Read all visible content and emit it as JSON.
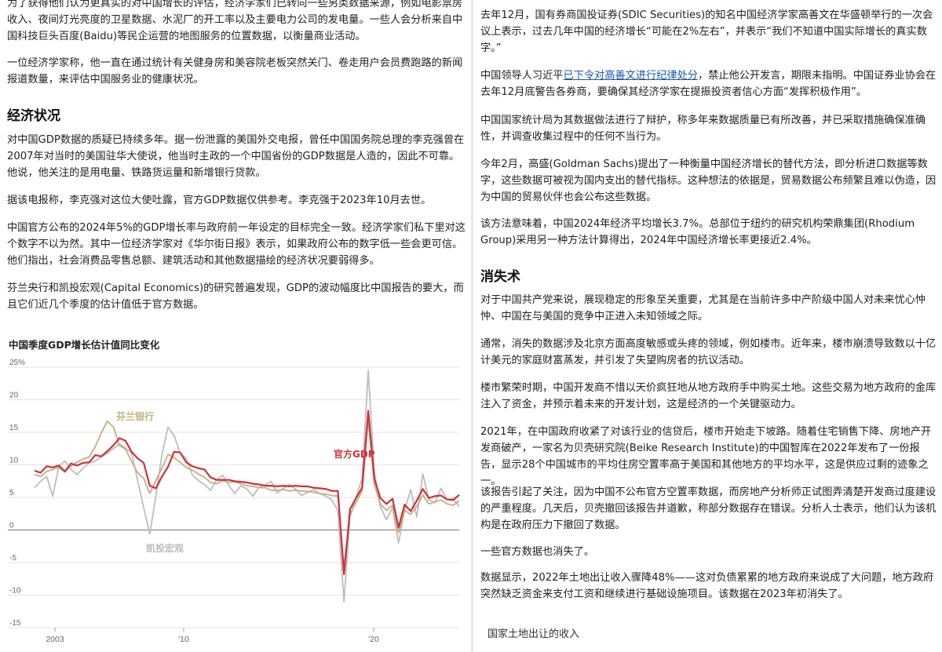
{
  "left": {
    "p0": "为了获得他们认为更真实的对中国增长的评估，经济学家们已转向一些另类数据来源，例如电影票房收入、夜间灯光亮度的卫星数据、水泥厂的开工率以及主要电力公司的发电量。一些人会分析来自中国科技巨头百度(Baidu)等民企运营的地图服务的位置数据，以衡量商业活动。",
    "p1": "一位经济学家称，他一直在通过统计有关健身房和美容院老板突然关门、卷走用户会员费跑路的新闻报道数量，来评估中国服务业的健康状况。",
    "h_econ": "经济状况",
    "p2": "对中国GDP数据的质疑已持续多年。据一份泄露的美国外交电报，曾任中国国务院总理的李克强曾在2007年对当时的美国驻华大使说，他当时主政的一个中国省份的GDP数据是人造的，因此不可靠。他说，他关注的是用电量、铁路货运量和新增银行贷款。",
    "p3": "据该电报称，李克强对这位大使吐露，官方GDP数据仅供参考。李克强于2023年10月去世。",
    "p4": "中国官方公布的2024年5%的GDP增长率与政府前一年设定的目标完全一致。经济学家们私下里对这个数字不以为然。其中一位经济学家对《华尔街日报》表示，如果政府公布的数字低一些会更可信。他们指出，社会消费品零售总额、建筑活动和其他数据描绘的经济状况要弱得多。",
    "p5": "芬兰央行和凯投宏观(Capital Economics)的研究普遍发现，GDP的波动幅度比中国报告的要大，而且它们近几个季度的估计值低于官方数据。"
  },
  "chart_data": {
    "type": "line",
    "title": "中国季度GDP增长估计值同比变化",
    "ylim": [
      -15,
      25
    ],
    "yticks": [
      "25%",
      "20",
      "15",
      "10",
      "5",
      "0",
      "-5",
      "-10",
      "-15"
    ],
    "xticks": [
      "2003",
      "'10",
      "'20"
    ],
    "grid": true,
    "series": [
      {
        "name": "官方GDP",
        "color": "#d0313c",
        "values": [
          9.1,
          8.8,
          9.8,
          9.6,
          9.9,
          9.0,
          10.2,
          9.9,
          10.3,
          10.4,
          11.5,
          11.3,
          12.1,
          13.0,
          14.1,
          13.7,
          12.0,
          11.0,
          10.3,
          6.8,
          6.4,
          8.2,
          9.7,
          12.0,
          11.9,
          10.4,
          9.8,
          9.5,
          9.3,
          8.1,
          7.7,
          7.7,
          7.7,
          7.5,
          7.4,
          7.3,
          7.1,
          7.0,
          6.8,
          6.8,
          6.7,
          6.8,
          6.7,
          6.8,
          6.7,
          6.7,
          6.5,
          6.4,
          6.3,
          6.0,
          6.0,
          -6.8,
          3.2,
          4.9,
          6.5,
          18.3,
          7.9,
          4.9,
          4.0,
          4.8,
          0.4,
          3.9,
          2.9,
          4.5,
          6.3,
          4.9,
          5.2,
          5.3,
          4.7,
          4.6,
          5.4
        ]
      },
      {
        "name": "芬兰银行",
        "color": "#c0b27e",
        "values": [
          8.5,
          8.2,
          9.0,
          9.3,
          9.6,
          8.9,
          9.8,
          10.4,
          10.9,
          11.2,
          12.8,
          14.9,
          16.7,
          15.8,
          13.0,
          12.4,
          10.5,
          8.8,
          7.9,
          5.6,
          7.6,
          9.5,
          11.6,
          11.1,
          10.4,
          9.6,
          9.2,
          8.6,
          8.1,
          7.3,
          7.1,
          7.6,
          7.3,
          7.4,
          7.1,
          6.8,
          6.7,
          6.5,
          6.5,
          6.1,
          6.1,
          6.2,
          6.0,
          6.1,
          6.0,
          5.9,
          5.8,
          5.6,
          5.5,
          5.3,
          5.2,
          -5.7,
          2.5,
          4.2,
          6.0,
          17.0,
          7.0,
          4.0,
          3.0,
          3.8,
          -0.4,
          3.0,
          2.4,
          3.6,
          5.4,
          4.0,
          4.3,
          4.6,
          4.0,
          3.8,
          4.5
        ]
      },
      {
        "name": "凯投宏观",
        "color": "#bdbdbd",
        "values": [
          6.5,
          7.5,
          8.2,
          5.2,
          9.8,
          10.6,
          9.3,
          8.5,
          9.5,
          10.3,
          10.6,
          11.2,
          11.8,
          12.5,
          13.2,
          12.6,
          11.8,
          7.6,
          3.4,
          -0.6,
          5.2,
          11.6,
          15.8,
          14.5,
          11.8,
          11.0,
          8.5,
          7.6,
          7.0,
          6.1,
          7.7,
          8.4,
          6.9,
          5.6,
          6.8,
          6.3,
          5.2,
          6.6,
          6.9,
          7.5,
          5.7,
          6.4,
          7.0,
          6.3,
          5.3,
          5.8,
          6.2,
          5.6,
          5.2,
          4.6,
          3.0,
          -11.0,
          2.0,
          5.0,
          8.0,
          24.5,
          9.0,
          3.6,
          1.6,
          3.4,
          -2.0,
          3.0,
          6.2,
          2.0,
          8.6,
          4.6,
          4.2,
          6.4,
          4.7,
          4.8,
          3.6
        ]
      }
    ],
    "labels": {
      "bof": "芬兰银行",
      "official": "官方GDP",
      "cap": "凯投宏观"
    }
  },
  "right": {
    "p0": "去年12月，国有券商国投证券(SDIC Securities)的知名中国经济学家高善文在华盛顿举行的一次会议上表示，过去几年中国的经济增长“可能在2%左右”，并表示“我们不知道中国实际增长的真实数字。”",
    "p1a": "中国领导人习近平",
    "p1link": "已下令对高善文进行纪律处分",
    "p1b": "，禁止他公开发言，期限未指明。中国证券业协会在去年12月底警告各券商，要确保其经济学家在提振投资者信心方面“发挥积极作用”。",
    "p2": "中国国家统计局为其数据做法进行了辩护，称多年来数据质量已有所改善，并已采取措施确保准确性，并调查收集过程中的任何不当行为。",
    "p3": "今年2月，高盛(Goldman Sachs)提出了一种衡量中国经济增长的替代方法，即分析进口数据等数字，这些数据可被视为国内支出的替代指标。这种想法的依据是，贸易数据公布频繁且难以伪造，因为中国的贸易伙伴也会公布这些数据。",
    "p4": "该方法意味着，中国2024年经济平均增长3.7%。总部位于纽约的研究机构荣鼎集团(Rhodium Group)采用另一种方法计算得出，2024年中国经济增长率更接近2.4%。",
    "h_vanish": "消失术",
    "p5": "对于中国共产党来说，展现稳定的形象至关重要，尤其是在当前许多中产阶级中国人对未来忧心忡忡、中国在与美国的竞争中正进入未知领域之际。",
    "p6": "通常，消失的数据涉及北京方面高度敏感或头疼的领域，例如楼市。近年来，楼市崩溃导致数以十亿计美元的家庭财富蒸发，并引发了失望购房者的抗议活动。",
    "p7": "楼市繁荣时期，中国开发商不惜以天价疯狂地从地方政府手中购买土地。这些交易为地方政府的金库注入了资金，并预示着未来的开发计划，这是经济的一个关键驱动力。",
    "p8": "2021年，在中国政府收紧了对该行业的信贷后，楼市开始走下坡路。随着住宅销售下降、房地产开发商破产，一家名为贝壳研究院(Beike Research Institute)的中国智库在2022年发布了一份报告，显示28个中国城市的平均住房空置率高于美国和其他地方的平均水平，这是供应过剩的迹象之一。",
    "p9": "该报告引起了关注，因为中国不公布官方空置率数据，而房地产分析师正试图弄清楚开发商过度建设的严重程度。几天后，贝壳撤回该报告并道歉，称部分数据存在错误。分析人士表示，他们认为该机构是在政府压力下撤回了数据。",
    "p10": "一些官方数据也消失了。",
    "p11": "数据显示，2022年土地出让收入骤降48%——这对负债累累的地方政府来说成了大问题，地方政府突然缺乏资金来支付工资和继续进行基础设施项目。该数据在2023年初消失了。",
    "land_title": "国家土地出让的收入"
  }
}
